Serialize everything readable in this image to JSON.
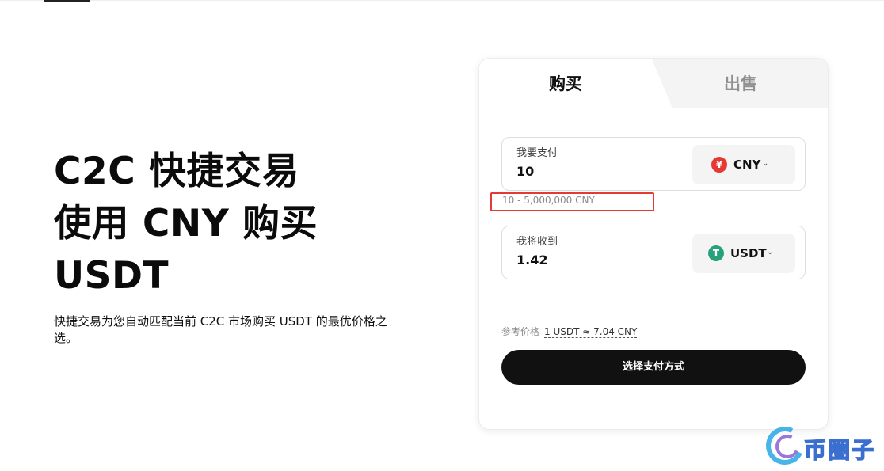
{
  "hero": {
    "title_line1": "C2C 快捷交易",
    "title_line2": "使用 CNY 购买",
    "title_line3": "USDT",
    "description": "快捷交易为您自动匹配当前 C2C 市场购买 USDT 的最优价格之选。"
  },
  "card": {
    "tabs": {
      "buy": "购买",
      "sell": "出售",
      "active": "buy"
    },
    "pay": {
      "label": "我要支付",
      "value": "10",
      "currency": "CNY",
      "currency_icon_glyph": "¥",
      "currency_icon": "cny-coin-icon",
      "icon_color": "#e53935"
    },
    "range_hint": "10 - 5,000,000 CNY",
    "receive": {
      "label": "我将收到",
      "value": "1.42",
      "currency": "USDT",
      "currency_icon_glyph": "T",
      "currency_icon": "usdt-coin-icon",
      "icon_color": "#26a17b"
    },
    "reference": {
      "label": "参考价格",
      "value": "1 USDT ≈ 7.04 CNY"
    },
    "cta_label": "选择支付方式"
  },
  "watermark": {
    "text": "币圈子"
  },
  "colors": {
    "highlight_box": "#e53935",
    "cta_background": "#111111"
  }
}
